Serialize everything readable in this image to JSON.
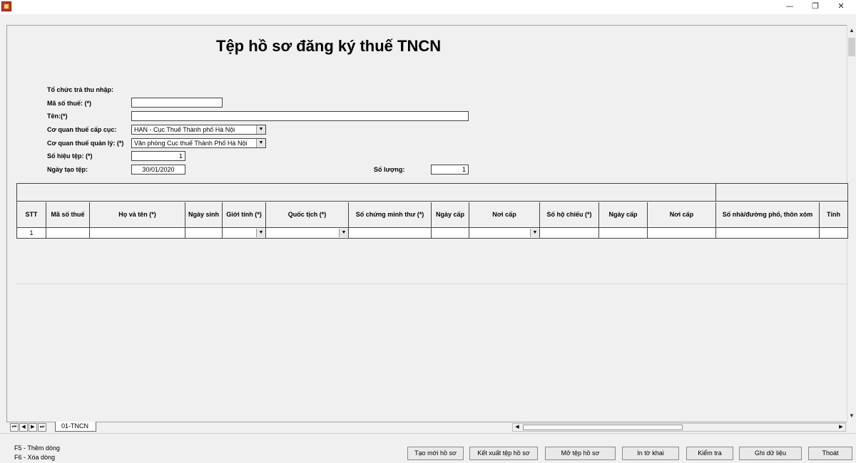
{
  "window": {
    "minimize_glyph": "—",
    "restore_glyph": "❐",
    "close_glyph": "✕"
  },
  "form": {
    "title": "Tệp hồ sơ đăng ký thuế TNCN",
    "org_label": "Tổ chức trả thu nhập:",
    "tax_code_label": "Mã số thuế: (*)",
    "tax_code_value": "",
    "name_label": "Tên:(*)",
    "name_value": "",
    "dept_label": "Cơ quan thuế cấp cục:",
    "dept_value": "HAN - Cục Thuế Thành phố Hà Nội",
    "office_label": "Cơ quan thuế quản lý: (*)",
    "office_value": "Văn phòng Cục thuế Thành Phố Hà Nội",
    "file_no_label": "Số hiệu tệp: (*)",
    "file_no_value": "1",
    "created_label": "Ngày tạo tệp:",
    "created_value": "30/01/2020",
    "count_label": "Số lượng:",
    "count_value": "1"
  },
  "grid": {
    "columns": [
      "STT",
      "Mã số thuế",
      "Họ và tên (*)",
      "Ngày sinh",
      "Giới tính (*)",
      "Quốc tịch (*)",
      "Số chứng minh thư (*)",
      "Ngày cấp",
      "Nơi cấp",
      "Số hộ chiếu (*)",
      "Ngày cấp",
      "Nơi cấp",
      "Số nhà/đường phố, thôn xóm",
      "Tỉnh"
    ],
    "rows": [
      [
        "1",
        "",
        "",
        "",
        "",
        "",
        "",
        "",
        "",
        "",
        "",
        "",
        "",
        ""
      ]
    ]
  },
  "tabs": {
    "sheet_tab": "01-TNCN",
    "nav": [
      "⏮",
      "◀",
      "▶",
      "⏭"
    ]
  },
  "status": {
    "hint_add": "F5 - Thêm dòng",
    "hint_delete": "F6 - Xóa dòng"
  },
  "buttons": {
    "new": "Tạo mới hồ sơ",
    "export": "Kết xuất tệp hồ sơ",
    "open": "Mở tệp hồ sơ",
    "print": "In tờ khai",
    "check": "Kiểm tra",
    "save": "Ghi dữ liệu",
    "exit": "Thoát"
  }
}
